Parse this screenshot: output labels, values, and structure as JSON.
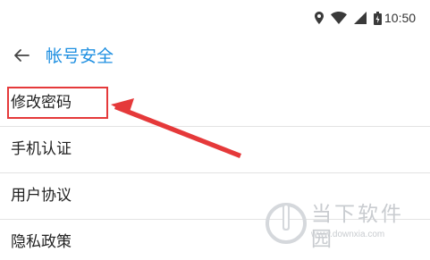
{
  "status_bar": {
    "icons": [
      "location-icon",
      "wifi-icon",
      "signal-icon",
      "battery-icon"
    ],
    "time": "10:50"
  },
  "app_bar": {
    "back_icon": "back-arrow-icon",
    "title": "帐号安全",
    "title_color": "#1e8fe1"
  },
  "menu": {
    "items": [
      {
        "label": "修改密码",
        "highlighted": true
      },
      {
        "label": "手机认证"
      },
      {
        "label": "用户协议"
      },
      {
        "label": "隐私政策"
      }
    ]
  },
  "annotation": {
    "color": "#e5393a",
    "target": "修改密码"
  },
  "watermark": {
    "brand": "当下软件园",
    "url": "www.downxia.com"
  }
}
